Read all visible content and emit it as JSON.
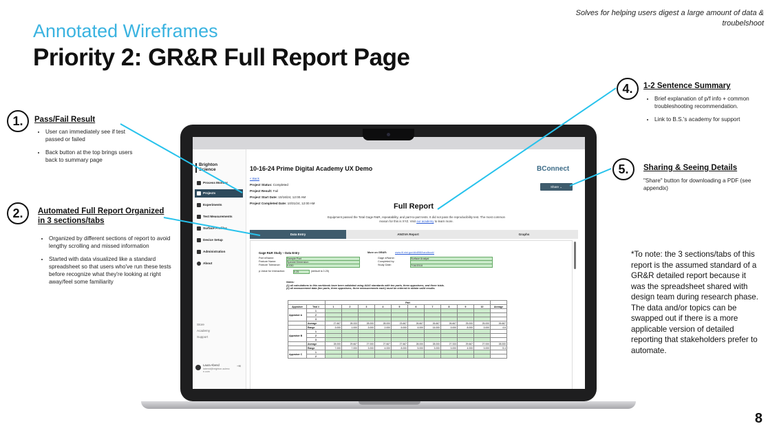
{
  "top_note": "Solves for helping users digest a large amount of data & troubelshoot",
  "subtitle": "Annotated Wireframes",
  "title": "Priority 2: GR&R Full Report Page",
  "page_number": "8",
  "accent_color": "#3ab3e0",
  "annotations": [
    {
      "num": "1.",
      "title": "Pass/Fail Result",
      "bullets": [
        "User can immediately see if test passed or failed",
        "Back button at the top brings users back to summary page"
      ]
    },
    {
      "num": "2.",
      "title": "Automated Full Report Organized in 3 sections/tabs",
      "bullets": [
        "Organized by different sections of report to avoid lengthy scrolling and missed information",
        "Started with data visualized like a standard spreadsheet so that users who've run these tests before recognize what they're looking at right away/feel some familiarity"
      ]
    },
    {
      "num": "4.",
      "title": "1-2 Sentence Summary",
      "bullets": [
        "Brief explanation of p/f info + common troubleshooting recommendation.",
        "Link to B.S.'s academy for support"
      ]
    },
    {
      "num": "5.",
      "title": "Sharing & Seeing Details",
      "text": "\"Share\" button for downloading a PDF (see appendix)"
    }
  ],
  "side_note": "*To note: the 3 sections/tabs of this report is the assumed standard of a GR&R detailed report because it was the spreadsheet shared with design team during research phase. The data and/or topics can be swapped out if there is a more applicable version of detailed reporting that stakeholders prefer to automate.",
  "app": {
    "logo": "Brighton\nScience",
    "nav": [
      "Process Monitor",
      "Projects",
      "Experiments",
      "Test Measurements",
      "Surface Profiles",
      "Device Setup",
      "Administration",
      "About"
    ],
    "active_nav": "Projects",
    "nav_bottom": [
      "Store",
      "Academy",
      "Support"
    ],
    "user_name": "Laura Abend",
    "user_email": "labend@brighton-science.com",
    "page_title": "10-16-24 Prime Digital Academy UX Demo",
    "brand": "BConnect",
    "back": "< Back",
    "status_label": "Project Status:",
    "status_value": "Completed",
    "result_label": "Project Result:",
    "result_value": "Fail",
    "start_label": "Project Start Date:",
    "start_value": "10/16/24, 12:00 AM",
    "completed_label": "Project Completed Date:",
    "completed_value": "10/31/24, 12:00 AM",
    "share": "Share",
    "report_title": "Full Report",
    "summary": "Equipment passed the Total Gage R&R, repeatability, and part-to-part tests. It did not pass the reproducibility test. The most common reason for this is XYZ. Visit ",
    "summary_link": "our academy",
    "summary_end": " to learn more.",
    "tabs": [
      "Data Entry",
      "ANOVA Report",
      "Graphs"
    ],
    "sheet_title": "Gage R&R Study – Data Entry",
    "more_label": "More on GR&R:",
    "more_link": "www.itl.nist.gov/div898/handbook/",
    "part_name_label": "Part #/Name:",
    "part_name_value": "Sample Part",
    "feature_label": "Feature Name:",
    "feature_value": "Special Dimension",
    "tolerance_label": "Feature Tolerance:",
    "tolerance_value": "0.030",
    "gage_label": "Gage #/Name:",
    "gage_value": "Surface Analyst",
    "completed_by_label": "Completed by:",
    "study_date_label": "Study Date:",
    "study_date_value": "7/16/2018",
    "pvalue_label": "p-Value for Interaction:",
    "pvalue_value": "0.25",
    "pvalue_default": "(default is 0.25)",
    "notes": "Notes:\n(1) all calculations in this workbook have been validated using AIAG standards with ten parts, three appraisers, and three trials.\n(2) all measurement data (ten parts, three appraisers, three measurements each) must be entered to obtain valid results.",
    "table_header": [
      "Appraiser",
      "Trial #",
      "1",
      "2",
      "3",
      "4",
      "5",
      "6",
      "7",
      "8",
      "9",
      "10",
      "Average"
    ],
    "table_part": "Part",
    "appraisers": [
      "Appraiser A",
      "Appraiser B",
      "Appraiser C"
    ],
    "average_label": "Average",
    "range_label": "Range",
    "row_a_avg": [
      "27.667",
      "28.333",
      "28.000",
      "28.000",
      "23.667",
      "26.667",
      "26.667",
      "26.667",
      "25.000",
      "25.000",
      "26.667"
    ],
    "row_a_range": [
      "3.000",
      "1.000",
      "3.000",
      "2.000",
      "5.000",
      "4.000",
      "14.000",
      "3.000",
      "8.000",
      "3.000",
      "4.6"
    ],
    "row_b_avg": [
      "28.000",
      "29.667",
      "27.000",
      "27.667",
      "27.667",
      "28.000",
      "28.000",
      "27.333",
      "29.667",
      "27.000",
      "28.000"
    ],
    "row_b_range": [
      "7.000",
      "7.000",
      "3.000",
      "4.000",
      "8.000",
      "5.000",
      "3.000",
      "3.000",
      "4.000",
      "3.000",
      "5.4"
    ]
  }
}
